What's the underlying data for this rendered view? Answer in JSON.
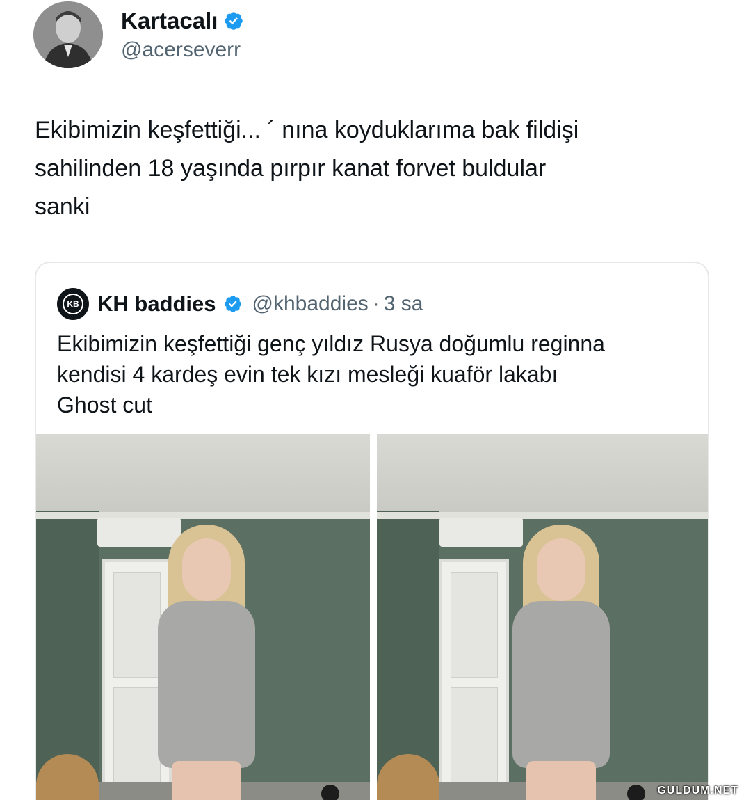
{
  "author": {
    "display_name": "Kartacalı",
    "handle": "@acerseverr",
    "avatar_icon": "profile-photo-icon",
    "verified": true
  },
  "tweet": {
    "text": "Ekibimizin keşfettiği... ´ nına koyduklarıma bak fildişi\nsahilinden 18 yaşında pırpır kanat forvet buldular\nsanki"
  },
  "quoted_tweet": {
    "logo_text": "KB",
    "display_name": "KH baddies",
    "handle": "@khbaddies",
    "separator": "·",
    "time": "3 sa",
    "text": "Ekibimizin keşfettiği genç yıldız Rusya doğumlu reginna\nkendisi 4 kardeş evin tek kızı mesleği kuaför lakabı\nGhost cut",
    "media_count": 2
  },
  "watermark": "GULDUM.NET",
  "colors": {
    "verified_badge": "#1d9bf0",
    "secondary_text": "#536471",
    "primary_text": "#0f1419",
    "border": "#e6e9ec"
  }
}
